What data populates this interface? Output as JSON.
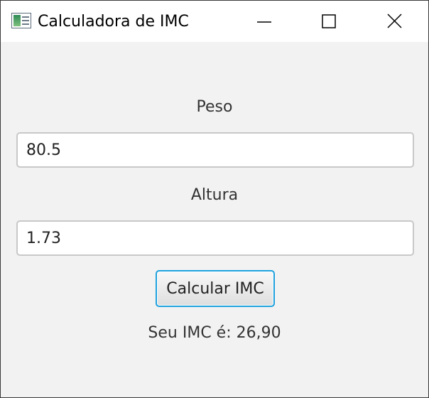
{
  "window": {
    "title": "Calculadora de IMC",
    "icon": "java-app-icon",
    "controls": {
      "minimize_icon": "minimize-icon",
      "maximize_icon": "maximize-icon",
      "close_icon": "close-icon"
    }
  },
  "form": {
    "peso_label": "Peso",
    "peso_value": "80.5",
    "altura_label": "Altura",
    "altura_value": "1.73",
    "button_label": "Calcular IMC",
    "result_text": "Seu IMC é: 26,90"
  },
  "colors": {
    "background": "#f2f2f2",
    "titlebar": "#ffffff",
    "button_focus_border": "#1ea1de",
    "field_border": "#c8c8c8"
  }
}
